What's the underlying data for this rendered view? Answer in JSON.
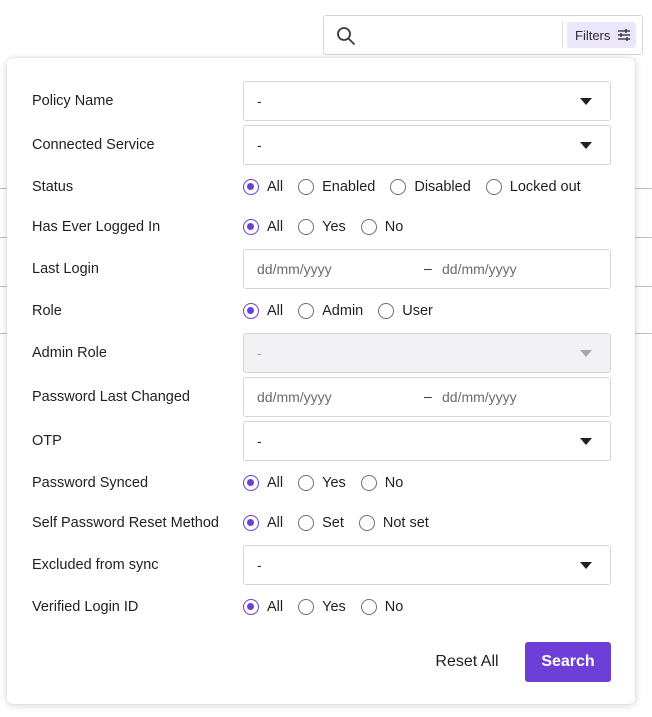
{
  "search": {
    "placeholder": "",
    "value": "",
    "filters_label": "Filters"
  },
  "colors": {
    "accent": "#6e3fd6",
    "filters_bg": "#ece6fb"
  },
  "fields": {
    "policy_name": {
      "label": "Policy Name",
      "value": "-"
    },
    "connected_service": {
      "label": "Connected Service",
      "value": "-"
    },
    "status": {
      "label": "Status",
      "options": [
        "All",
        "Enabled",
        "Disabled",
        "Locked out"
      ],
      "selected": "All"
    },
    "has_ever_logged_in": {
      "label": "Has Ever Logged In",
      "options": [
        "All",
        "Yes",
        "No"
      ],
      "selected": "All"
    },
    "last_login": {
      "label": "Last Login",
      "from": "dd/mm/yyyy",
      "separator": "–",
      "to": "dd/mm/yyyy"
    },
    "role": {
      "label": "Role",
      "options": [
        "All",
        "Admin",
        "User"
      ],
      "selected": "All"
    },
    "admin_role": {
      "label": "Admin Role",
      "value": "-",
      "disabled": true
    },
    "password_last_changed": {
      "label": "Password Last Changed",
      "from": "dd/mm/yyyy",
      "separator": "–",
      "to": "dd/mm/yyyy"
    },
    "otp": {
      "label": "OTP",
      "value": "-"
    },
    "password_synced": {
      "label": "Password Synced",
      "options": [
        "All",
        "Yes",
        "No"
      ],
      "selected": "All"
    },
    "self_password_reset": {
      "label": "Self Password Reset Method",
      "options": [
        "All",
        "Set",
        "Not set"
      ],
      "selected": "All"
    },
    "excluded_from_sync": {
      "label": "Excluded from sync",
      "value": "-"
    },
    "verified_login_id": {
      "label": "Verified Login ID",
      "options": [
        "All",
        "Yes",
        "No"
      ],
      "selected": "All"
    }
  },
  "actions": {
    "reset_label": "Reset All",
    "search_label": "Search"
  }
}
